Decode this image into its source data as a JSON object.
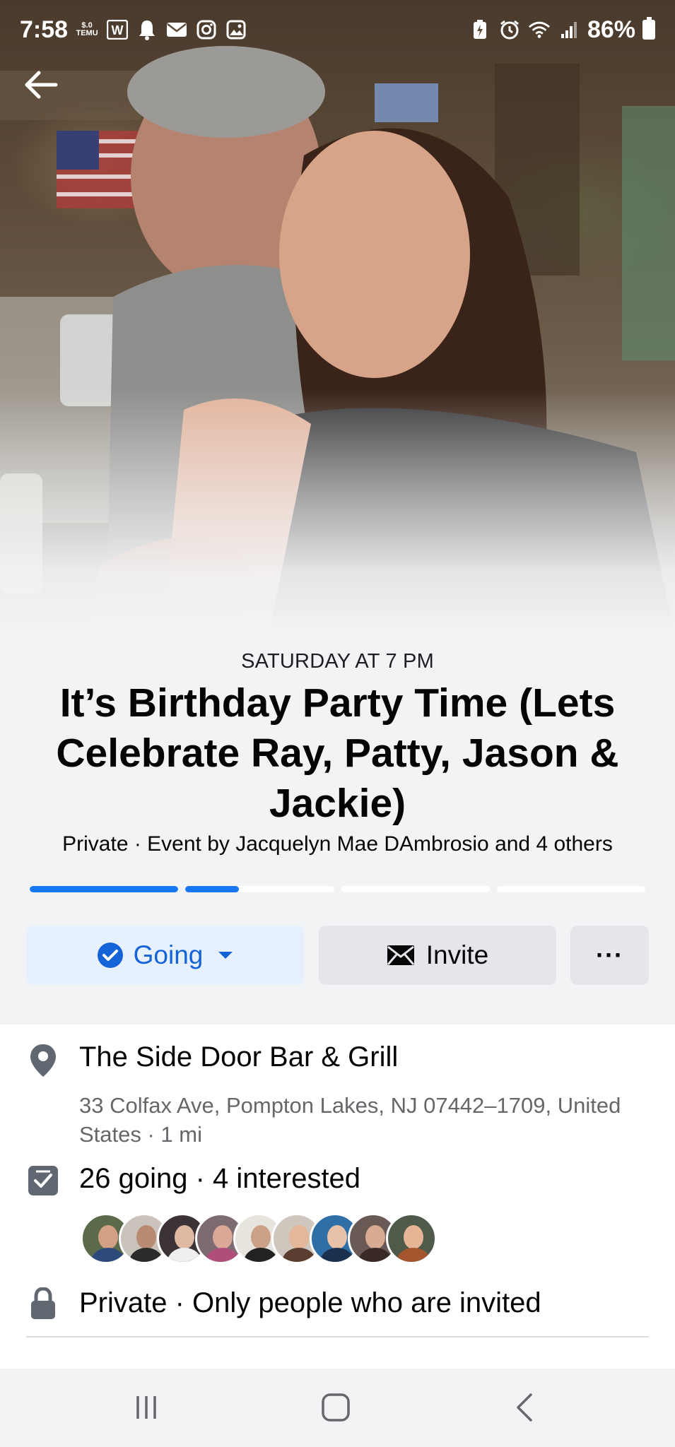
{
  "status_bar": {
    "time": "7:58",
    "temu_label": "TEMU",
    "temu_price": "$.0",
    "battery": "86%"
  },
  "event": {
    "date": "SATURDAY AT 7 PM",
    "title": "It’s Birthday Party Time (Lets Celebrate Ray, Patty, Jason & Jackie)",
    "host": "Private · Event by Jacquelyn Mae DAmbrosio and 4 others",
    "photo_progress": [
      1.0,
      0.36,
      0.0,
      0.0
    ]
  },
  "actions": {
    "going_label": "Going",
    "invite_label": "Invite",
    "more_label": "···"
  },
  "location": {
    "name": "The Side Door Bar & Grill",
    "address": "33 Colfax Ave, Pompton Lakes, NJ 07442–1709, United States · 1 mi"
  },
  "attendance": {
    "summary": "26 going · 4 interested",
    "avatar_count": 9
  },
  "privacy": {
    "text": "Private · Only people who are invited"
  },
  "colors": {
    "accent": "#1877f2",
    "going_bg": "#e7f0fd",
    "button_bg": "#e4e6eb",
    "secondary_text": "#65676b",
    "icon_gray": "#606770"
  },
  "icons": {
    "back": "arrow-left-icon",
    "going": "check-circle-icon",
    "dropdown": "caret-down-icon",
    "invite": "envelope-icon",
    "location": "map-pin-icon",
    "attendance": "checkbox-icon",
    "privacy": "lock-icon"
  }
}
